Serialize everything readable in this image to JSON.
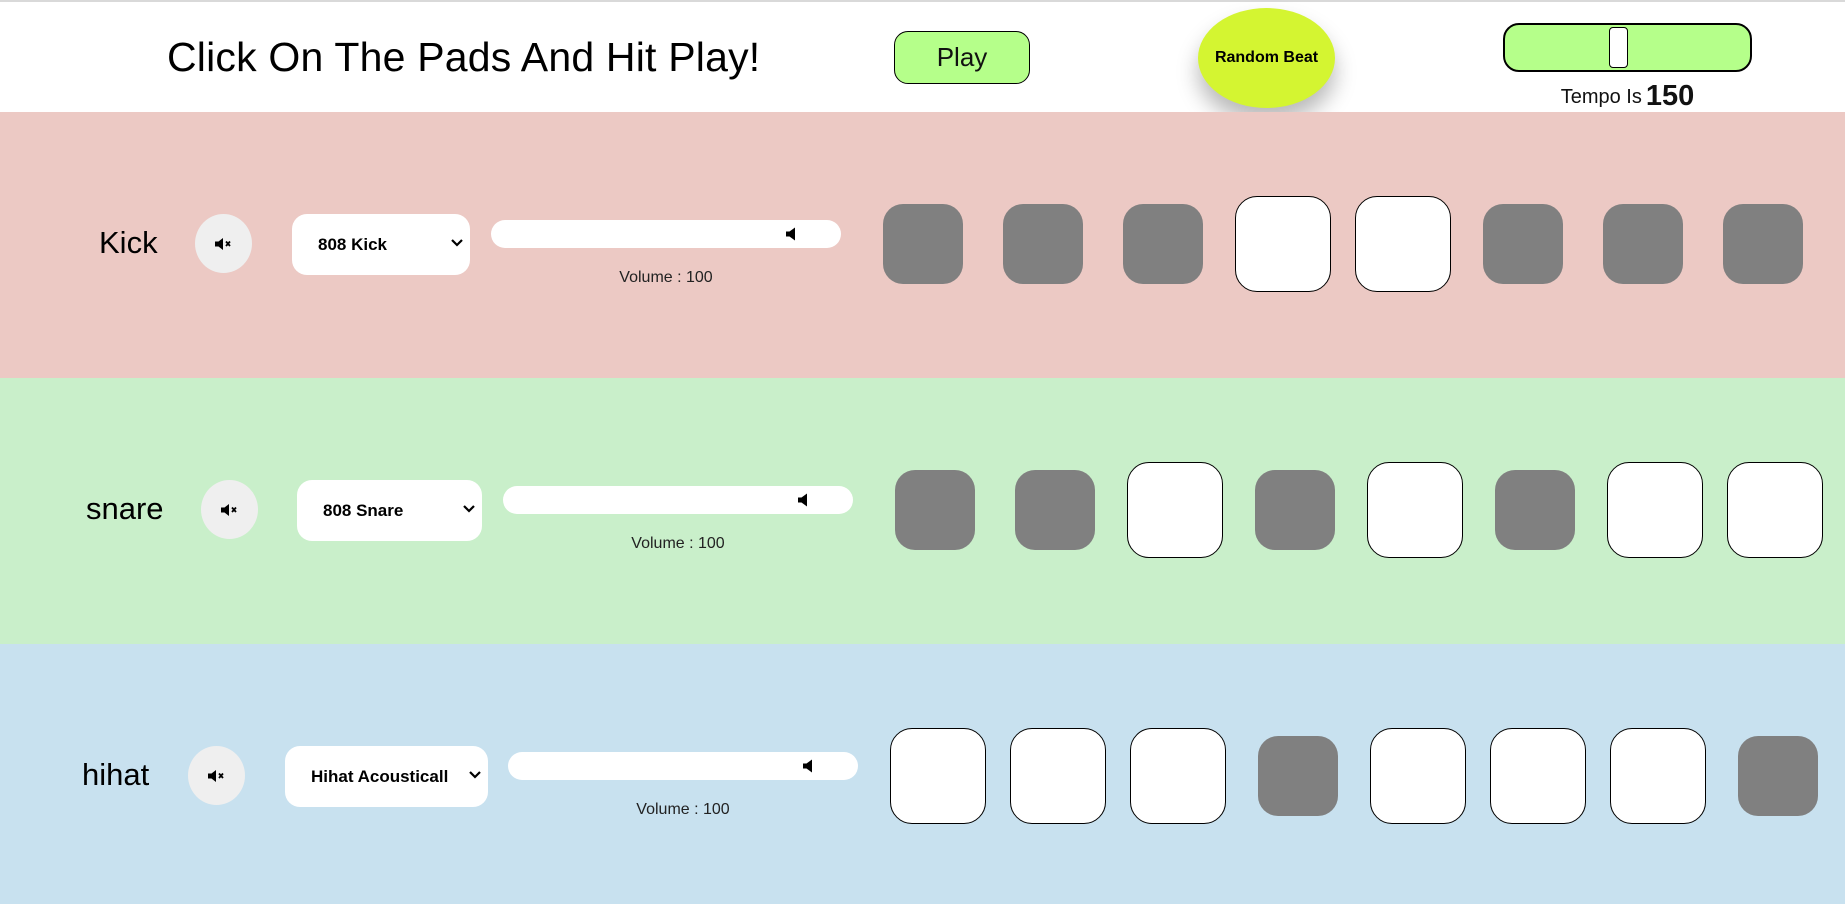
{
  "header": {
    "title": "Click On The Pads And Hit Play!",
    "play_label": "Play",
    "random_label": "Random Beat",
    "tempo_prefix": "Tempo Is",
    "tempo_value": "150",
    "tempo_slider_fraction": 0.46
  },
  "colors": {
    "kick_bg": "#ecc9c4",
    "snare_bg": "#c9efca",
    "hihat_bg": "#c8e1ef",
    "play_green": "#b5ff8a",
    "random_yellow": "#d4f531",
    "pad_off": "#808080",
    "pad_on": "#ffffff"
  },
  "tracks": [
    {
      "name": "Kick",
      "sample": "808 Kick",
      "volume_label": "Volume : 100",
      "pads": [
        false,
        false,
        false,
        true,
        true,
        false,
        false,
        false
      ]
    },
    {
      "name": "snare",
      "sample": "808 Snare",
      "volume_label": "Volume : 100",
      "pads": [
        false,
        false,
        true,
        false,
        true,
        false,
        true,
        true
      ]
    },
    {
      "name": "hihat",
      "sample": "Hihat Acousticall",
      "volume_label": "Volume : 100",
      "pads": [
        true,
        true,
        true,
        false,
        true,
        true,
        true,
        false
      ]
    }
  ],
  "icons": {
    "mute": "muted-speaker-icon",
    "volume": "speaker-icon",
    "dropdown": "chevron-down-icon"
  }
}
